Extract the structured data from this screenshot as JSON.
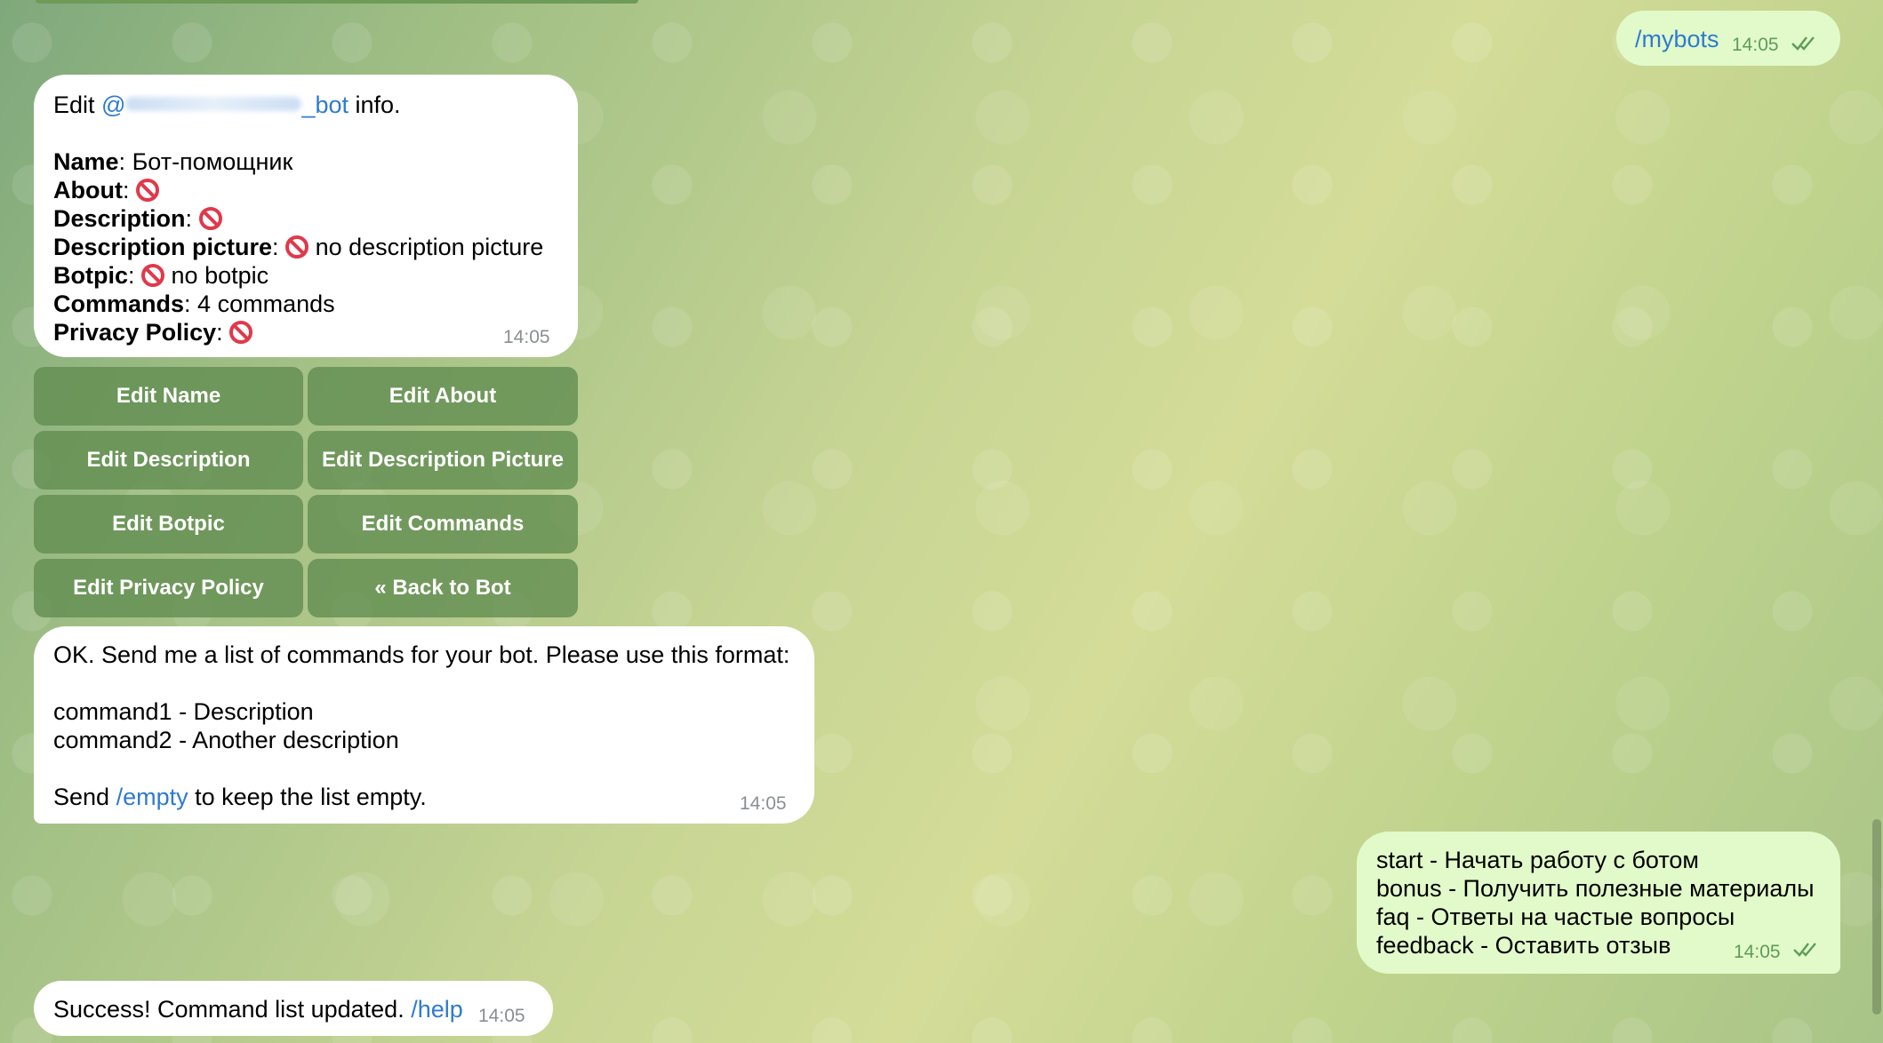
{
  "outgoing_mybots": {
    "command": "/mybots",
    "time": "14:05"
  },
  "bot_info": {
    "edit_prefix": "Edit ",
    "bot_handle_visible": "@",
    "bot_handle_suffix": "_bot",
    "edit_suffix": " info.",
    "name_label": "Name",
    "name_value": "Бот-помощник",
    "about_label": "About",
    "description_label": "Description",
    "description_picture_label": "Description picture",
    "description_picture_value": "no description picture",
    "botpic_label": "Botpic",
    "botpic_value": "no botpic",
    "commands_label": "Commands",
    "commands_value": "4 commands",
    "privacy_label": "Privacy Policy",
    "time": "14:05"
  },
  "keyboard": {
    "edit_name": "Edit Name",
    "edit_about": "Edit About",
    "edit_description": "Edit Description",
    "edit_description_picture": "Edit Description Picture",
    "edit_botpic": "Edit Botpic",
    "edit_commands": "Edit Commands",
    "edit_privacy_policy": "Edit Privacy Policy",
    "back_to_bot": "« Back to Bot"
  },
  "commands_prompt": {
    "line1": "OK. Send me a list of commands for your bot. Please use this format:",
    "line2": "command1 - Description",
    "line3": "command2 - Another description",
    "send_prefix": "Send ",
    "empty_link": "/empty",
    "send_suffix": " to keep the list empty.",
    "time": "14:05"
  },
  "user_commands": {
    "line1": "start - Начать работу с ботом",
    "line2": "bonus - Получить полезные материалы",
    "line3": "faq - Ответы на частые вопросы",
    "line4": "feedback - Оставить отзыв",
    "time": "14:05"
  },
  "success": {
    "text": "Success! Command list updated. ",
    "help_link": "/help",
    "time": "14:05"
  },
  "colors": {
    "link": "#2e7bd0",
    "outgoing_bubble": "#e2fac9",
    "keyboard_button": "#608c50",
    "forbidden": "#e0394b"
  }
}
